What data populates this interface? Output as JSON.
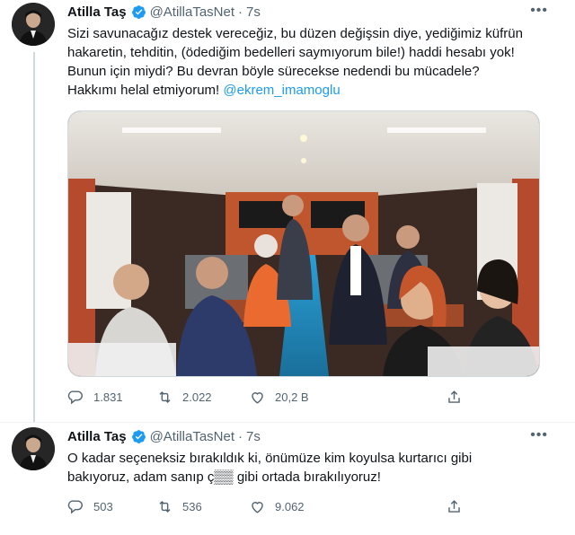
{
  "tweets": [
    {
      "name": "Atilla Taş",
      "handle": "@AtillaTasNet",
      "time": "7s",
      "text_lines": [
        "Sizi savunacağız destek vereceğiz, bu düzen değişsin diye, yediğimiz küfrün",
        "hakaretin, tehditin, (ödediğim bedelleri saymıyorum bile!) haddi hesabı yok!",
        "Bunun için miydi? Bu devran böyle sürecekse nedendi bu mücadele?",
        "Hakkımı helal etmiyorum!"
      ],
      "mention": "@ekrem_imamoglu",
      "replies": "1.831",
      "retweets": "2.022",
      "likes": "20,2 B"
    },
    {
      "name": "Atilla Taş",
      "handle": "@AtillaTasNet",
      "time": "7s",
      "text_lines": [
        "O kadar seçeneksiz bırakıldık ki, önümüze kim koyulsa kurtarıcı gibi",
        "bakıyoruz, adam sanıp ç▒▒ gibi ortada bırakılıyoruz!"
      ],
      "replies": "503",
      "retweets": "536",
      "likes": "9.062"
    }
  ],
  "icons": {
    "reply": "reply-icon",
    "retweet": "retweet-icon",
    "like": "heart-icon",
    "share": "share-icon",
    "verified": "verified-badge-icon",
    "more": "more-icon"
  },
  "colors": {
    "accent": "#1d9bf0",
    "secondary_text": "#536471",
    "thread_line": "#cfd9de"
  }
}
